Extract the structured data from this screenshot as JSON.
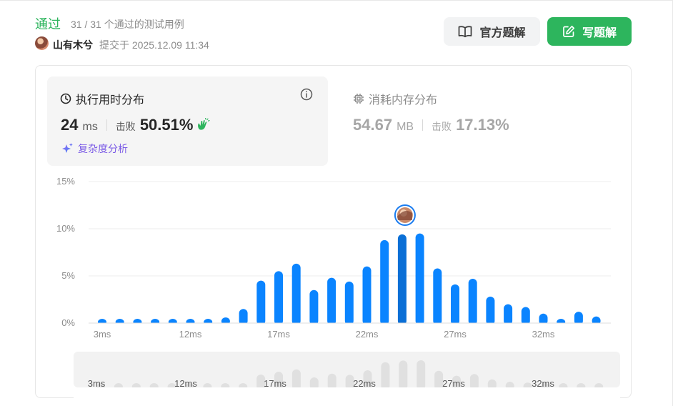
{
  "header": {
    "status": "通过",
    "cases": "31 / 31 个通过的测试用例",
    "author": "山有木兮",
    "submitted": "提交于 2025.12.09 11:34",
    "official_solution_label": "官方题解",
    "write_solution_label": "写题解"
  },
  "runtime": {
    "title": "执行用时分布",
    "value": "24",
    "unit": "ms",
    "beat_label": "击败",
    "beat_percent": "50.51%",
    "complexity_label": "复杂度分析"
  },
  "memory": {
    "title": "消耗内存分布",
    "value": "54.67",
    "unit": "MB",
    "beat_label": "击败",
    "beat_percent": "17.13%"
  },
  "colors": {
    "accent_green": "#2db55d",
    "bar_blue": "#0a84ff",
    "bar_highlight": "#0a6fd6",
    "complexity_purple": "#7b5be6"
  },
  "icons": {
    "book": "book-open-icon",
    "edit": "edit-icon",
    "clock": "clock-icon",
    "info": "info-icon",
    "chip": "chip-icon",
    "sparkle": "sparkle-icon",
    "clap": "clap-icon"
  },
  "chart_data": {
    "type": "bar",
    "ylim": [
      0,
      15
    ],
    "yticks": [
      "0%",
      "5%",
      "10%",
      "15%"
    ],
    "xticks": [
      "3ms",
      "12ms",
      "17ms",
      "22ms",
      "27ms",
      "32ms"
    ],
    "values": [
      0.4,
      0.4,
      0.4,
      0.4,
      0.4,
      0.4,
      0.4,
      0.6,
      1.5,
      4.5,
      5.5,
      6.3,
      3.5,
      4.8,
      4.4,
      6.0,
      8.8,
      9.4,
      9.5,
      5.8,
      4.1,
      4.7,
      2.8,
      2.0,
      1.7,
      1.0,
      0.4,
      1.2,
      0.7
    ],
    "highlight_index": 17,
    "grid": true,
    "navigator_xticks": [
      "3ms",
      "12ms",
      "17ms",
      "22ms",
      "27ms",
      "32ms"
    ]
  }
}
